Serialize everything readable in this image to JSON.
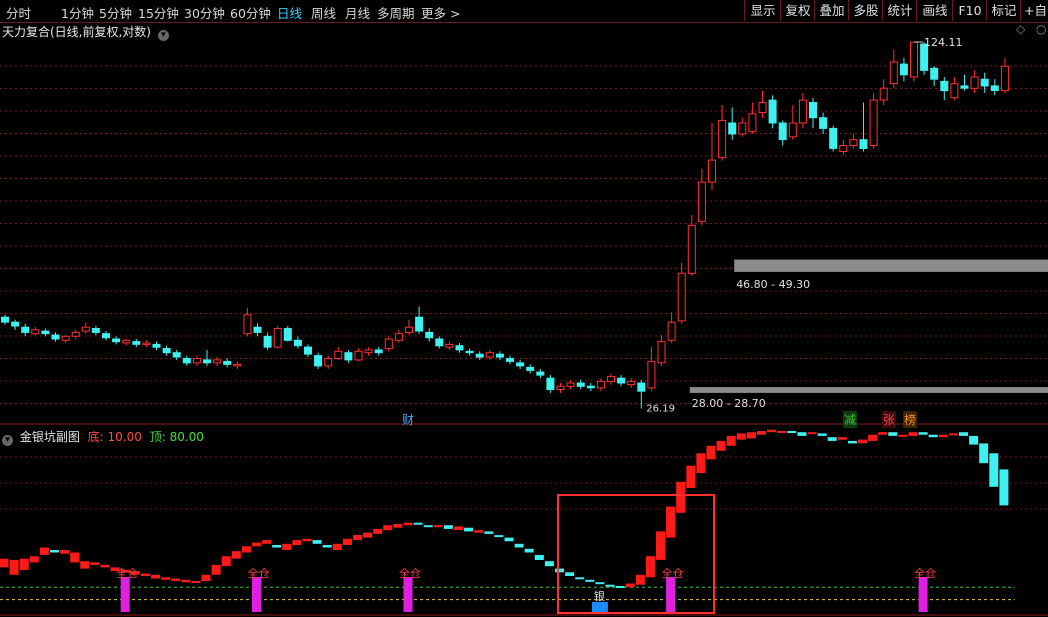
{
  "toolbar": {
    "periods": [
      "分时",
      "1分钟",
      "5分钟",
      "15分钟",
      "30分钟",
      "60分钟",
      "日线",
      "周线",
      "月线",
      "多周期",
      "更多 >"
    ],
    "active_period": "日线",
    "right_buttons": [
      "显示",
      "复权",
      "叠加",
      "多股",
      "统计",
      "画线",
      "F10",
      "标记",
      "+自选"
    ]
  },
  "main_chart": {
    "title": "天力复合(日线,前复权,对数)",
    "high_label": "124.11",
    "low_label": "26.19",
    "band_upper_label": "46.80 - 49.30",
    "band_lower_label": "28.00 - 28.70",
    "event_markers": [
      {
        "text": "财",
        "color": "#4aa3ff"
      },
      {
        "text": "减",
        "color": "#40c040",
        "bg": "#0e3a0e"
      },
      {
        "text": "张",
        "color": "#ff4040",
        "bg": "#3a0e0e"
      },
      {
        "text": "榜",
        "color": "#ff9020",
        "bg": "#3a2408"
      }
    ],
    "colors": {
      "up": "#ff3030",
      "down": "#3ff0f0",
      "grid": "#7a1a1a",
      "band": "#8c8c8c"
    }
  },
  "sub_chart": {
    "title": "金银坑副图",
    "param1_label": "底: 10.00",
    "param2_label": "顶: 80.00",
    "signal_label": "全仓",
    "silver_label": "银",
    "colors": {
      "red": "#ff1a1a",
      "cyan": "#3ff0f0",
      "magenta": "#e020e0",
      "box": "#ff3030",
      "param1": "#ff4a4a",
      "param2": "#40e040"
    }
  },
  "chart_data": [
    {
      "type": "candlestick",
      "title": "天力复合(日线,前复权,对数)",
      "scale": "log",
      "ylim": [
        20,
        140
      ],
      "candles": [
        [
          38.6,
          37.8,
          39.0,
          37.4
        ],
        [
          37.8,
          37.2,
          38.2,
          36.6
        ],
        [
          37.0,
          36.2,
          37.6,
          35.6
        ],
        [
          36.0,
          36.6,
          37.0,
          35.8
        ],
        [
          36.4,
          36.0,
          36.8,
          35.6
        ],
        [
          35.8,
          35.2,
          36.2,
          34.8
        ],
        [
          35.0,
          35.6,
          35.8,
          34.6
        ],
        [
          35.6,
          36.2,
          36.6,
          35.2
        ],
        [
          36.4,
          37.0,
          37.8,
          36.0
        ],
        [
          36.8,
          36.2,
          37.2,
          35.8
        ],
        [
          36.0,
          35.4,
          36.4,
          35.0
        ],
        [
          35.2,
          34.8,
          35.6,
          34.4
        ],
        [
          34.6,
          35.0,
          35.2,
          34.2
        ],
        [
          34.8,
          34.4,
          35.2,
          34.0
        ],
        [
          34.4,
          34.6,
          35.0,
          34.0
        ],
        [
          34.4,
          34.0,
          34.8,
          33.6
        ],
        [
          33.8,
          33.2,
          34.2,
          32.8
        ],
        [
          33.2,
          32.6,
          33.6,
          32.2
        ],
        [
          32.4,
          31.8,
          32.8,
          31.4
        ],
        [
          31.8,
          32.4,
          32.8,
          31.4
        ],
        [
          32.2,
          31.8,
          33.6,
          31.4
        ],
        [
          31.8,
          32.2,
          32.6,
          31.4
        ],
        [
          32.0,
          31.6,
          32.4,
          31.2
        ],
        [
          31.4,
          31.6,
          32.0,
          31.0
        ],
        [
          36.0,
          39.0,
          40.2,
          35.6
        ],
        [
          37.0,
          36.2,
          37.6,
          35.6
        ],
        [
          35.6,
          34.0,
          36.2,
          33.6
        ],
        [
          34.0,
          36.8,
          37.2,
          33.8
        ],
        [
          36.8,
          35.0,
          37.2,
          34.8
        ],
        [
          35.0,
          34.2,
          35.6,
          33.8
        ],
        [
          34.0,
          33.0,
          34.4,
          32.6
        ],
        [
          32.8,
          31.4,
          33.2,
          31.0
        ],
        [
          31.4,
          32.4,
          32.8,
          31.0
        ],
        [
          32.4,
          33.4,
          34.0,
          32.2
        ],
        [
          33.2,
          32.2,
          33.6,
          31.8
        ],
        [
          32.2,
          33.4,
          33.8,
          32.0
        ],
        [
          33.2,
          33.6,
          34.0,
          32.8
        ],
        [
          33.6,
          33.2,
          34.0,
          32.8
        ],
        [
          33.8,
          35.2,
          35.6,
          33.4
        ],
        [
          35.0,
          36.0,
          36.6,
          34.6
        ],
        [
          36.2,
          37.0,
          38.2,
          35.8
        ],
        [
          38.6,
          36.4,
          40.4,
          36.0
        ],
        [
          36.2,
          35.4,
          36.8,
          34.8
        ],
        [
          35.2,
          34.2,
          35.6,
          33.8
        ],
        [
          34.0,
          34.4,
          34.8,
          33.6
        ],
        [
          34.2,
          33.6,
          34.6,
          33.2
        ],
        [
          33.4,
          33.2,
          33.8,
          32.8
        ],
        [
          33.0,
          32.6,
          33.4,
          32.2
        ],
        [
          32.6,
          33.2,
          33.6,
          32.2
        ],
        [
          33.0,
          32.6,
          33.4,
          32.2
        ],
        [
          32.4,
          32.0,
          32.8,
          31.6
        ],
        [
          31.8,
          31.4,
          32.2,
          31.0
        ],
        [
          31.2,
          30.8,
          31.6,
          30.4
        ],
        [
          30.6,
          30.2,
          31.0,
          29.8
        ],
        [
          29.8,
          28.4,
          30.2,
          28.0
        ],
        [
          28.4,
          28.8,
          29.2,
          28.0
        ],
        [
          28.8,
          29.2,
          29.6,
          28.4
        ],
        [
          29.2,
          28.8,
          29.6,
          28.4
        ],
        [
          28.8,
          28.6,
          29.2,
          28.2
        ],
        [
          28.6,
          29.4,
          29.8,
          28.2
        ],
        [
          29.4,
          30.0,
          30.4,
          29.0
        ],
        [
          29.8,
          29.2,
          30.2,
          28.8
        ],
        [
          29.0,
          29.4,
          29.8,
          28.6
        ],
        [
          29.2,
          28.2,
          29.6,
          26.2
        ],
        [
          28.6,
          32.0,
          34.0,
          28.2
        ],
        [
          31.8,
          34.8,
          35.8,
          31.4
        ],
        [
          35.0,
          37.8,
          39.4,
          34.6
        ],
        [
          38.0,
          46.5,
          48.6,
          37.6
        ],
        [
          46.5,
          57.0,
          59.6,
          46.0
        ],
        [
          58.0,
          68.5,
          72.5,
          57.0
        ],
        [
          68.5,
          75.2,
          88.0,
          66.2
        ],
        [
          76.0,
          89.0,
          95.0,
          75.0
        ],
        [
          88.0,
          84.0,
          94.0,
          82.0
        ],
        [
          84.0,
          88.0,
          90.0,
          83.0
        ],
        [
          85.0,
          91.5,
          96.0,
          84.0
        ],
        [
          92.0,
          96.0,
          101.0,
          90.0
        ],
        [
          97.0,
          88.0,
          99.0,
          86.0
        ],
        [
          88.0,
          82.0,
          89.0,
          80.0
        ],
        [
          83.0,
          88.0,
          95.0,
          82.0
        ],
        [
          88.0,
          97.0,
          100.0,
          86.0
        ],
        [
          96.0,
          90.0,
          98.0,
          86.0
        ],
        [
          90.0,
          86.0,
          92.0,
          84.0
        ],
        [
          86.0,
          79.0,
          87.0,
          78.0
        ],
        [
          78.0,
          80.0,
          82.0,
          77.0
        ],
        [
          80.0,
          82.0,
          84.0,
          79.0
        ],
        [
          82.0,
          79.0,
          96.0,
          78.0
        ],
        [
          80.0,
          97.0,
          100.0,
          79.0
        ],
        [
          97.0,
          102.0,
          106.0,
          95.0
        ],
        [
          104.0,
          114.0,
          120.0,
          102.0
        ],
        [
          113.0,
          108.0,
          116.0,
          105.0
        ],
        [
          107.0,
          124.0,
          124.11,
          105.0
        ],
        [
          123.0,
          110.0,
          124.0,
          108.0
        ],
        [
          111.0,
          106.0,
          112.0,
          103.0
        ],
        [
          105.0,
          101.0,
          107.0,
          97.0
        ],
        [
          98.0,
          104.0,
          107.0,
          97.0
        ],
        [
          103.0,
          102.0,
          108.0,
          101.0
        ],
        [
          102.0,
          107.0,
          110.0,
          100.0
        ],
        [
          106.0,
          103.0,
          109.0,
          100.0
        ],
        [
          103.0,
          101.0,
          106.0,
          99.0
        ],
        [
          101.0,
          112.0,
          116.0,
          100.0
        ]
      ],
      "bands": [
        {
          "low": 46.8,
          "high": 49.3
        },
        {
          "low": 28.0,
          "high": 28.7
        }
      ],
      "marked_high": 124.11,
      "marked_low": 26.19
    },
    {
      "type": "bar",
      "title": "金银坑副图",
      "ylim": [
        0,
        100
      ],
      "values": [
        [
          36,
          43
        ],
        [
          30,
          42
        ],
        [
          34,
          43
        ],
        [
          40,
          45
        ],
        [
          46,
          52
        ],
        [
          50,
          48
        ],
        [
          47,
          50
        ],
        [
          40,
          48
        ],
        [
          35,
          41
        ],
        [
          38,
          40
        ],
        [
          36,
          38
        ],
        [
          33,
          36
        ],
        [
          32,
          34
        ],
        [
          30,
          33
        ],
        [
          29,
          31
        ],
        [
          27,
          30
        ],
        [
          26,
          28
        ],
        [
          25,
          27
        ],
        [
          24,
          26
        ],
        [
          24,
          25
        ],
        [
          25,
          30
        ],
        [
          30,
          38
        ],
        [
          37,
          45
        ],
        [
          43,
          49
        ],
        [
          48,
          53
        ],
        [
          53,
          56
        ],
        [
          55,
          58
        ],
        [
          54,
          52
        ],
        [
          50,
          55
        ],
        [
          54,
          58
        ],
        [
          57,
          59
        ],
        [
          58,
          55
        ],
        [
          54,
          52
        ],
        [
          50,
          55
        ],
        [
          54,
          59
        ],
        [
          58,
          62
        ],
        [
          60,
          64
        ],
        [
          63,
          67
        ],
        [
          66,
          70
        ],
        [
          68,
          71
        ],
        [
          70,
          72
        ],
        [
          72,
          71
        ],
        [
          70,
          69
        ],
        [
          69,
          70
        ],
        [
          70,
          67
        ],
        [
          66,
          69
        ],
        [
          68,
          65
        ],
        [
          64,
          66
        ],
        [
          65,
          63
        ],
        [
          62,
          61
        ],
        [
          60,
          57
        ],
        [
          55,
          52
        ],
        [
          51,
          48
        ],
        [
          46,
          42
        ],
        [
          41,
          37
        ],
        [
          35,
          32
        ],
        [
          32,
          29
        ],
        [
          28,
          27
        ],
        [
          26,
          25
        ],
        [
          24,
          23
        ],
        [
          22,
          21
        ],
        [
          21,
          20
        ],
        [
          20,
          23
        ],
        [
          22,
          30
        ],
        [
          28,
          45
        ],
        [
          42,
          65
        ],
        [
          60,
          85
        ],
        [
          80,
          105
        ],
        [
          100,
          118
        ],
        [
          112,
          128
        ],
        [
          123,
          134
        ],
        [
          130,
          138
        ],
        [
          134,
          142
        ],
        [
          139,
          144
        ],
        [
          140,
          145
        ],
        [
          143,
          146
        ],
        [
          145,
          147
        ],
        [
          146,
          146
        ],
        [
          146,
          145
        ],
        [
          145,
          142
        ],
        [
          144,
          145
        ],
        [
          144,
          142
        ],
        [
          141,
          138
        ],
        [
          139,
          141
        ],
        [
          138,
          136
        ],
        [
          136,
          139
        ],
        [
          138,
          143
        ],
        [
          143,
          145
        ],
        [
          145,
          142
        ],
        [
          142,
          143
        ],
        [
          142,
          145
        ],
        [
          145,
          143
        ],
        [
          143,
          141
        ],
        [
          141,
          143
        ],
        [
          143,
          144
        ],
        [
          145,
          142
        ],
        [
          142,
          135
        ],
        [
          136,
          120
        ],
        [
          128,
          101
        ],
        [
          115,
          86
        ]
      ],
      "reference_lines": [
        10,
        20
      ],
      "signals": [
        12,
        25,
        40,
        66,
        91
      ],
      "silver_marker": 59
    }
  ]
}
